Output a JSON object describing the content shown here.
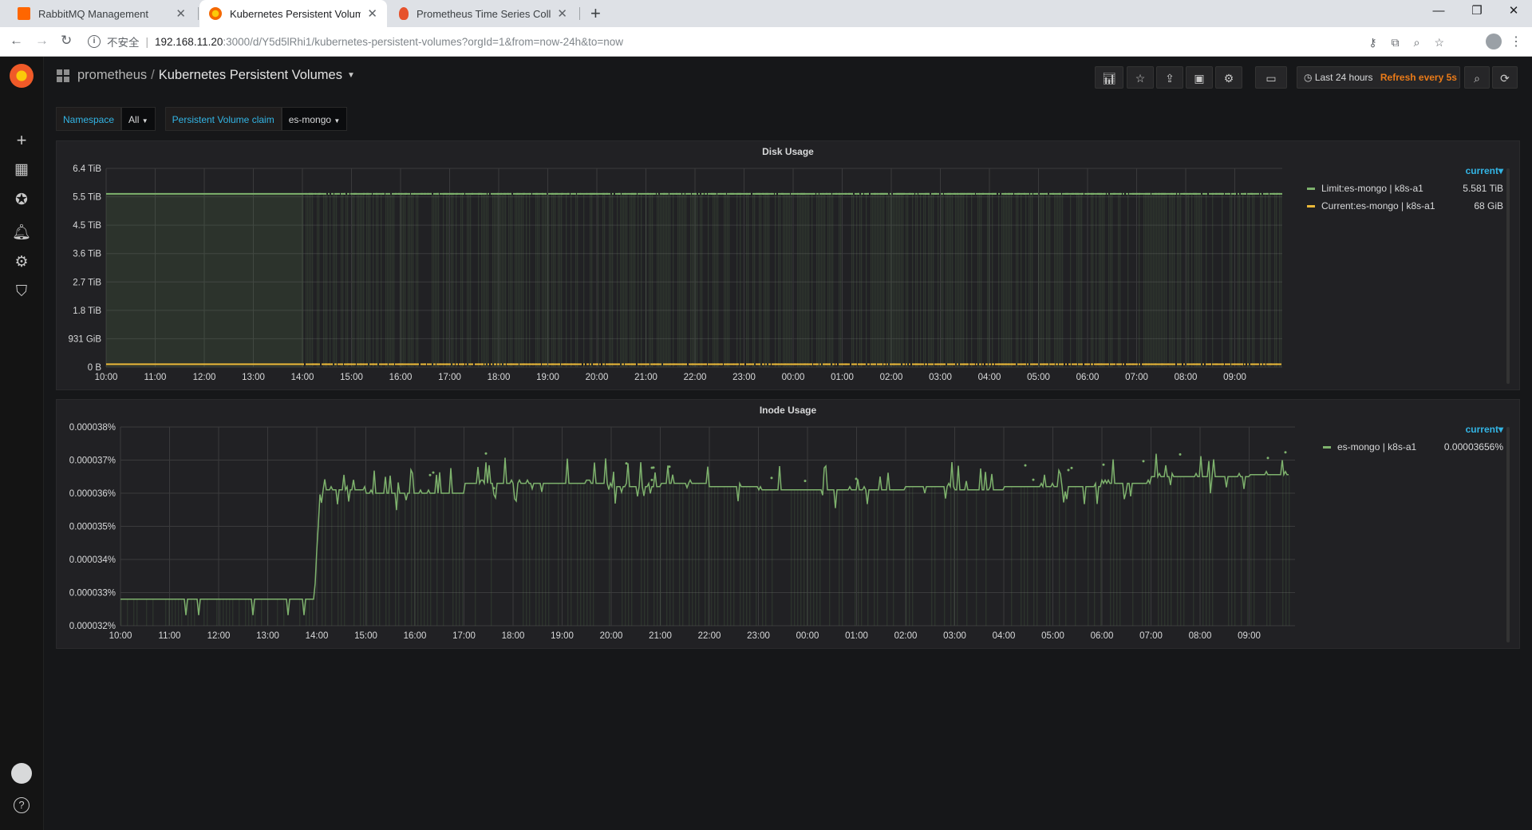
{
  "browser": {
    "tabs": [
      {
        "title": "RabbitMQ Management",
        "favicon_color": "#ff6600"
      },
      {
        "title": "Kubernetes Persistent Volumes -",
        "favicon_color": "#f46800"
      },
      {
        "title": "Prometheus Time Series Collectio",
        "favicon_color": "#e6522c"
      }
    ],
    "address": {
      "security_label": "不安全",
      "host": "192.168.11.20",
      "rest": ":3000/d/Y5d5lRhi1/kubernetes-persistent-volumes?orgId=1&from=now-24h&to=now"
    }
  },
  "navbar": {
    "folder": "prometheus",
    "separator": "/",
    "dashboard": "Kubernetes Persistent Volumes",
    "time_range": "Last 24 hours",
    "refresh": "Refresh every 5s"
  },
  "variables": [
    {
      "label": "Namespace",
      "value": "All"
    },
    {
      "label": "Persistent Volume claim",
      "value": "es-mongo"
    }
  ],
  "colors": {
    "green": "#7eb26d",
    "yellow": "#eab839",
    "accent": "#33b5e5",
    "refresh": "#eb7b18"
  },
  "disk_panel": {
    "title": "Disk Usage",
    "legend_header": "current",
    "legend": [
      {
        "name": "Limit:es-mongo | k8s-a1",
        "value": "5.581 TiB"
      },
      {
        "name": "Current:es-mongo | k8s-a1",
        "value": "68 GiB"
      }
    ],
    "y_ticks": [
      "6.4 TiB",
      "5.5 TiB",
      "4.5 TiB",
      "3.6 TiB",
      "2.7 TiB",
      "1.8 TiB",
      "931 GiB",
      "0 B"
    ]
  },
  "inode_panel": {
    "title": "Inode Usage",
    "legend_header": "current",
    "legend": [
      {
        "name": "es-mongo | k8s-a1",
        "value": "0.00003656%"
      }
    ],
    "y_ticks": [
      "0.000038%",
      "0.000037%",
      "0.000036%",
      "0.000035%",
      "0.000034%",
      "0.000033%",
      "0.000032%"
    ]
  },
  "x_ticks": [
    "10:00",
    "11:00",
    "12:00",
    "13:00",
    "14:00",
    "15:00",
    "16:00",
    "17:00",
    "18:00",
    "19:00",
    "20:00",
    "21:00",
    "22:00",
    "23:00",
    "00:00",
    "01:00",
    "02:00",
    "03:00",
    "04:00",
    "05:00",
    "06:00",
    "07:00",
    "08:00",
    "09:00"
  ],
  "chart_data": [
    {
      "type": "line",
      "title": "Disk Usage",
      "x": [
        "10:00",
        "11:00",
        "12:00",
        "13:00",
        "14:00",
        "15:00",
        "16:00",
        "17:00",
        "18:00",
        "19:00",
        "20:00",
        "21:00",
        "22:00",
        "23:00",
        "00:00",
        "01:00",
        "02:00",
        "03:00",
        "04:00",
        "05:00",
        "06:00",
        "07:00",
        "08:00",
        "09:00"
      ],
      "ylabel": "",
      "ylim_tib": [
        0,
        6.4
      ],
      "series": [
        {
          "name": "Limit:es-mongo | k8s-a1",
          "unit": "TiB",
          "values": [
            5.581,
            5.581,
            5.581,
            5.581,
            5.581,
            5.581,
            5.581,
            5.581,
            5.581,
            5.581,
            5.581,
            5.581,
            5.581,
            5.581,
            5.581,
            5.581,
            5.581,
            5.581,
            5.581,
            5.581,
            5.581,
            5.581,
            5.581,
            5.581
          ]
        },
        {
          "name": "Current:es-mongo | k8s-a1",
          "unit": "GiB",
          "values": [
            68,
            68,
            68,
            68,
            68,
            68,
            68,
            68,
            68,
            68,
            68,
            68,
            68,
            68,
            68,
            68,
            68,
            68,
            68,
            68,
            68,
            68,
            68,
            68
          ]
        }
      ],
      "legend": "right",
      "grid": true
    },
    {
      "type": "line",
      "title": "Inode Usage",
      "x": [
        "10:00",
        "11:00",
        "12:00",
        "13:00",
        "14:00",
        "15:00",
        "16:00",
        "17:00",
        "18:00",
        "19:00",
        "20:00",
        "21:00",
        "22:00",
        "23:00",
        "00:00",
        "01:00",
        "02:00",
        "03:00",
        "04:00",
        "05:00",
        "06:00",
        "07:00",
        "08:00",
        "09:00"
      ],
      "ylabel": "",
      "ylim": [
        3.2e-05,
        3.8e-05
      ],
      "series": [
        {
          "name": "es-mongo | k8s-a1",
          "unit": "%",
          "values": [
            3.28e-05,
            3.28e-05,
            3.28e-05,
            3.28e-05,
            3.61e-05,
            3.6e-05,
            3.6e-05,
            3.63e-05,
            3.63e-05,
            3.63e-05,
            3.62e-05,
            3.63e-05,
            3.62e-05,
            3.61e-05,
            3.61e-05,
            3.61e-05,
            3.62e-05,
            3.61e-05,
            3.62e-05,
            3.62e-05,
            3.63e-05,
            3.65e-05,
            3.65e-05,
            3.656e-05
          ]
        }
      ],
      "legend": "right",
      "grid": true
    }
  ]
}
